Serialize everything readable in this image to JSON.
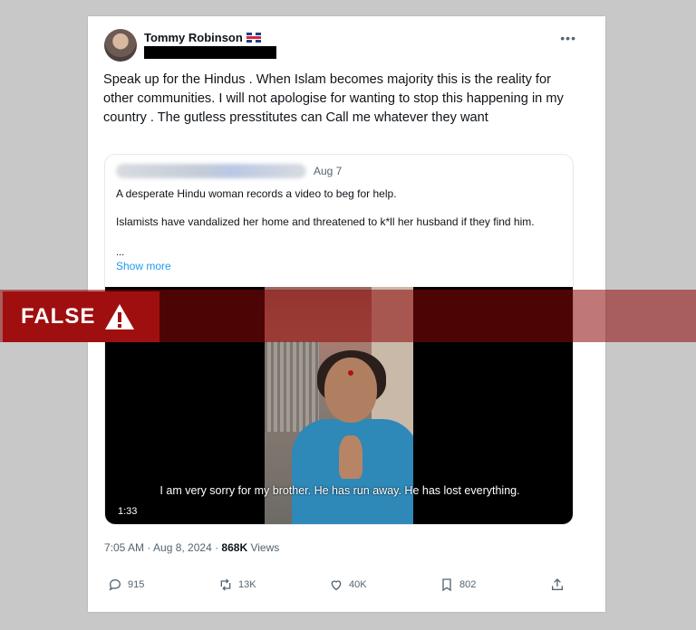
{
  "post": {
    "author_name": "Tommy Robinson",
    "author_flag": "uk-flag-icon",
    "text": "Speak up for the Hindus . When Islam becomes majority this is the reality for other communities. I will not apologise for wanting to stop this happening in my country . The gutless presstitutes can Call me whatever they want",
    "timestamp": "7:05 AM · Aug 8, 2024 · ",
    "views_count": "868K",
    "views_label": " Views"
  },
  "quote": {
    "date": "Aug 7",
    "line1": "A desperate Hindu woman records a video to beg for help.",
    "line2": "Islamists have vandalized her home and threatened to k*ll her husband if they find him.",
    "ellipsis": "...",
    "show_more": "Show more"
  },
  "video": {
    "subtitle": "I am very sorry for my brother. He has run away. He has lost everything.",
    "duration": "1:33"
  },
  "actions": {
    "replies": "915",
    "reposts": "13K",
    "likes": "40K",
    "bookmarks": "802"
  },
  "overlay": {
    "label": "FALSE",
    "colors": {
      "label_bg": "#a00f0f",
      "banner_bg": "#8c0808"
    }
  }
}
